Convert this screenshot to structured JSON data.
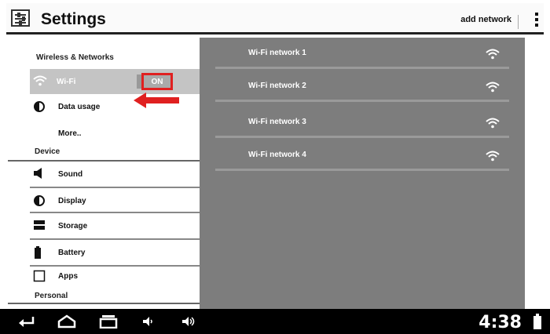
{
  "header": {
    "title": "Settings",
    "add_network": "add network",
    "app_icon": "settings-sliders-icon",
    "overflow_icon": "overflow-menu-icon"
  },
  "sidebar": {
    "sections": {
      "wireless": "Wireless & Networks",
      "device": "Device",
      "personal": "Personal"
    },
    "wifi": {
      "label": "Wi-Fi",
      "toggle": "ON",
      "icon": "wifi-icon"
    },
    "data_usage": {
      "label": "Data usage",
      "icon": "data-usage-icon"
    },
    "more": {
      "label": "More.."
    },
    "device_items": [
      {
        "label": "Sound",
        "icon": "speaker-icon"
      },
      {
        "label": "Display",
        "icon": "brightness-icon"
      },
      {
        "label": "Storage",
        "icon": "storage-icon"
      },
      {
        "label": "Battery",
        "icon": "battery-icon"
      },
      {
        "label": "Apps",
        "icon": "apps-icon"
      }
    ]
  },
  "networks": [
    {
      "name": "Wi-Fi network 1",
      "icon": "wifi-signal-icon"
    },
    {
      "name": "Wi-Fi network 2",
      "icon": "wifi-signal-icon"
    },
    {
      "name": "Wi-Fi network 3",
      "icon": "wifi-signal-icon"
    },
    {
      "name": "Wi-Fi network 4",
      "icon": "wifi-signal-icon"
    }
  ],
  "navbar": {
    "time": "4:38",
    "icons": [
      "back-icon",
      "home-icon",
      "recent-apps-icon",
      "volume-down-icon",
      "volume-up-icon",
      "battery-status-icon"
    ]
  },
  "colors": {
    "highlight": "#e02020",
    "network_panel": "#7d7d7d",
    "selected_row": "#c4c4c4",
    "navbar": "#000000"
  }
}
